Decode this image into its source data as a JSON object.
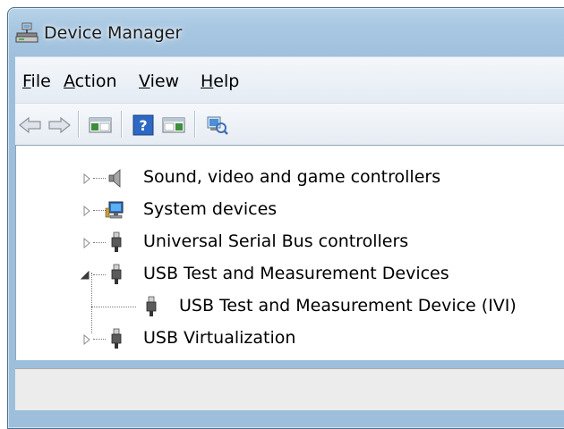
{
  "window": {
    "title": "Device Manager",
    "app_icon": "device-manager-icon"
  },
  "menu": {
    "items": [
      {
        "accel": "F",
        "rest": "ile"
      },
      {
        "accel": "A",
        "rest": "ction"
      },
      {
        "accel": "V",
        "rest": "iew"
      },
      {
        "accel": "H",
        "rest": "elp"
      }
    ]
  },
  "toolbar": {
    "buttons": [
      "back-arrow-icon",
      "forward-arrow-icon",
      "show-hide-console-tree-icon",
      "help-icon",
      "properties-pane-icon",
      "scan-hardware-changes-icon"
    ]
  },
  "tree": {
    "items": [
      {
        "label": "Sound, video and game controllers",
        "icon": "speaker-icon",
        "state": "collapsed"
      },
      {
        "label": "System devices",
        "icon": "computer-icon",
        "state": "collapsed"
      },
      {
        "label": "Universal Serial Bus controllers",
        "icon": "usb-plug-icon",
        "state": "collapsed"
      },
      {
        "label": "USB Test and Measurement Devices",
        "icon": "usb-plug-icon",
        "state": "expanded"
      },
      {
        "label": "USB Test and Measurement Device (IVI)",
        "icon": "usb-plug-icon",
        "state": "child"
      },
      {
        "label": "USB Virtualization",
        "icon": "usb-plug-icon",
        "state": "collapsed"
      }
    ]
  },
  "statusbar": {
    "text": ""
  }
}
